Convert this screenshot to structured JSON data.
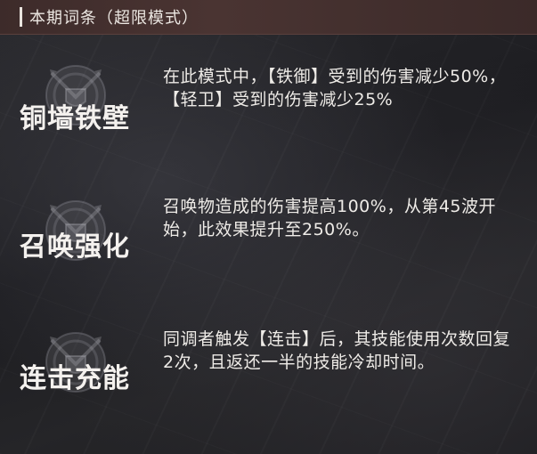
{
  "header": {
    "title": "本期词条（超限模式）"
  },
  "entries": [
    {
      "name": "铜墙铁壁",
      "description": "在此模式中，【铁御】受到的伤害减少50%，【轻卫】受到的伤害减少25%",
      "icon": "crossed-swords-shield-emblem"
    },
    {
      "name": "召唤强化",
      "description": "召唤物造成的伤害提高100%，从第45波开始，此效果提升至250%。",
      "icon": "crossed-swords-shield-emblem"
    },
    {
      "name": "连击充能",
      "description": "同调者触发【连击】后，其技能使用次数回复2次，且返还一半的技能冷却时间。",
      "icon": "crossed-swords-shield-emblem"
    }
  ]
}
